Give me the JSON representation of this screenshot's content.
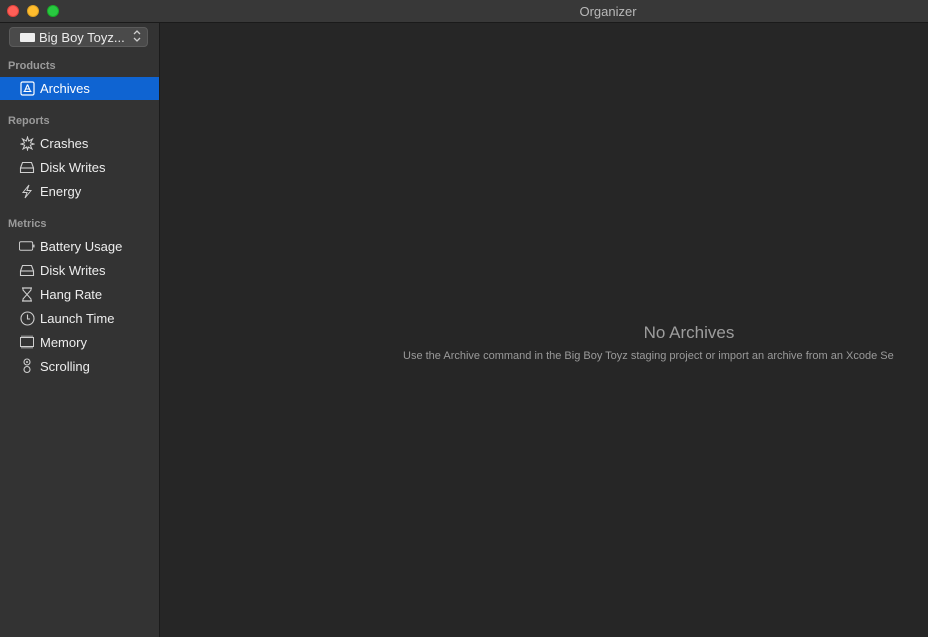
{
  "window": {
    "title": "Organizer",
    "controls": [
      "close",
      "minimize",
      "zoom"
    ]
  },
  "sidebar": {
    "scheme_popup": {
      "label": "Big Boy Toyz...",
      "icon": "device-icon"
    },
    "sections": [
      {
        "header": "Products",
        "items": [
          {
            "label": "Archives",
            "icon": "archive-icon",
            "selected": true
          }
        ]
      },
      {
        "header": "Reports",
        "items": [
          {
            "label": "Crashes",
            "icon": "crash-icon"
          },
          {
            "label": "Disk Writes",
            "icon": "disk-icon"
          },
          {
            "label": "Energy",
            "icon": "energy-icon"
          }
        ]
      },
      {
        "header": "Metrics",
        "items": [
          {
            "label": "Battery Usage",
            "icon": "battery-icon"
          },
          {
            "label": "Disk Writes",
            "icon": "disk-icon"
          },
          {
            "label": "Hang Rate",
            "icon": "hourglass-icon"
          },
          {
            "label": "Launch Time",
            "icon": "clock-icon"
          },
          {
            "label": "Memory",
            "icon": "memory-icon"
          },
          {
            "label": "Scrolling",
            "icon": "scrolling-icon"
          }
        ]
      }
    ]
  },
  "main": {
    "empty_title": "No Archives",
    "empty_subtitle": "Use the Archive command in the Big Boy Toyz staging project or import an archive from an Xcode Se"
  },
  "colors": {
    "selection": "#0f64d2",
    "sidebar_bg": "#333333",
    "content_bg": "#262626"
  }
}
